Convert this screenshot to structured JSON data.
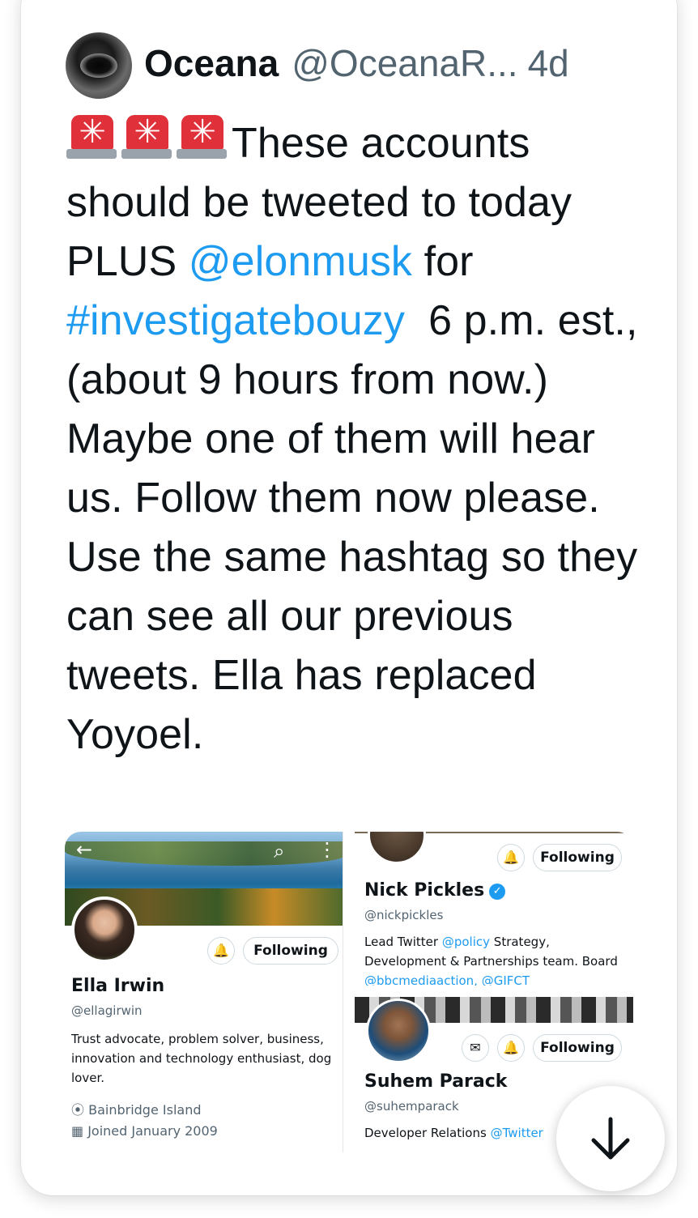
{
  "tweet": {
    "author_name": "Oceana",
    "author_handle": "@OceanaR...",
    "time": "4d",
    "emoji_icon": "police-car-light-icon",
    "text_intro": "These accounts should be tweeted to today PLUS ",
    "mention": "@elonmusk",
    "text_for": " for ",
    "hashtag": "#investigatebouzy",
    "text_rest": "  6 p.m. est., (about 9 hours from now.)",
    "text_para2": "Maybe one of them will hear us. Follow them now please. Use the same hashtag so they can see all our previous tweets.  Ella has replaced Yoyoel."
  },
  "media": {
    "ella": {
      "name": "Ella Irwin",
      "handle": "@ellagirwin",
      "following_label": "Following",
      "bio": "Trust advocate, problem solver, business, innovation and technology enthusiast, dog lover.",
      "location": "Bainbridge Island",
      "joined": "Joined January 2009"
    },
    "nick": {
      "name": "Nick Pickles",
      "handle": "@nickpickles",
      "following_label": "Following",
      "bio_1": "Lead Twitter ",
      "bio_link1": "@policy",
      "bio_2": " Strategy, Development & Partnerships team. Board ",
      "bio_link2": "@bbcmediaaction, @GIFCT"
    },
    "suhem": {
      "name": "Suhem Parack",
      "handle": "@suhemparack",
      "following_label": "Following",
      "bio": "Developer Relations ",
      "bio_link": "@Twitter"
    }
  },
  "colors": {
    "link": "#1d9bf0",
    "text": "#0f1419",
    "secondary": "#536471",
    "siren": "#e0303a"
  }
}
